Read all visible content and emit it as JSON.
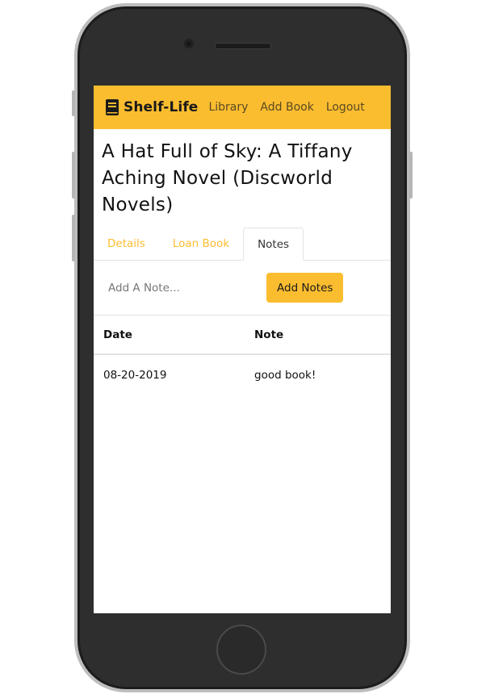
{
  "navbar": {
    "brand": "Shelf-Life",
    "links": [
      "Library",
      "Add Book",
      "Logout"
    ]
  },
  "book": {
    "title": "A Hat Full of Sky: A Tiffany Aching Novel (Discworld Novels)"
  },
  "tabs": [
    {
      "label": "Details",
      "active": false
    },
    {
      "label": "Loan Book",
      "active": false
    },
    {
      "label": "Notes",
      "active": true
    }
  ],
  "note_form": {
    "placeholder": "Add A Note...",
    "value": "",
    "submit_label": "Add Notes"
  },
  "notes_table": {
    "headers": [
      "Date",
      "Note"
    ],
    "rows": [
      {
        "date": "08-20-2019",
        "note": "good book!"
      }
    ]
  },
  "colors": {
    "accent": "#fbbd30",
    "phone_body": "#2e2e2e"
  },
  "icons": {
    "brand": "book-icon"
  }
}
